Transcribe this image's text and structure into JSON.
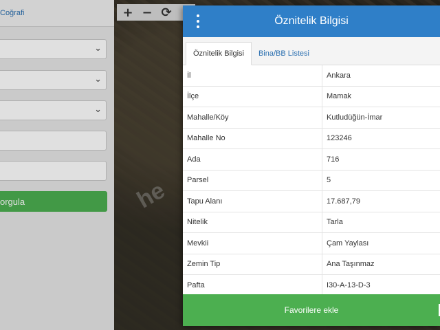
{
  "left_panel": {
    "tab_label": "Coğrafi",
    "query_button": "orgula"
  },
  "map": {
    "watermark": "he",
    "toolbar": [
      {
        "name": "zoom-in",
        "glyph": "+"
      },
      {
        "name": "zoom-out",
        "glyph": "−"
      },
      {
        "name": "refresh",
        "glyph": "⟳"
      }
    ]
  },
  "dialog": {
    "title": "Öznitelik Bilgisi",
    "tabs": [
      "Öznitelik Bilgisi",
      "Bina/BB Listesi"
    ],
    "rows": [
      {
        "key": "İl",
        "value": "Ankara"
      },
      {
        "key": "İlçe",
        "value": "Mamak"
      },
      {
        "key": "Mahalle/Köy",
        "value": "Kutludüğün-İmar"
      },
      {
        "key": "Mahalle No",
        "value": "123246"
      },
      {
        "key": "Ada",
        "value": "716"
      },
      {
        "key": "Parsel",
        "value": "5"
      },
      {
        "key": "Tapu Alanı",
        "value": "17.687,79"
      },
      {
        "key": "Nitelik",
        "value": "Tarla"
      },
      {
        "key": "Mevkii",
        "value": "Çam Yaylası"
      },
      {
        "key": "Zemin Tip",
        "value": "Ana Taşınmaz"
      },
      {
        "key": "Pafta",
        "value": "I30-A-13-D-3"
      }
    ],
    "favorite_button": "Favorilere ekle"
  },
  "colors": {
    "header": "#2f7fc8",
    "accent_green": "#4caf50",
    "link": "#2a6fb0"
  }
}
